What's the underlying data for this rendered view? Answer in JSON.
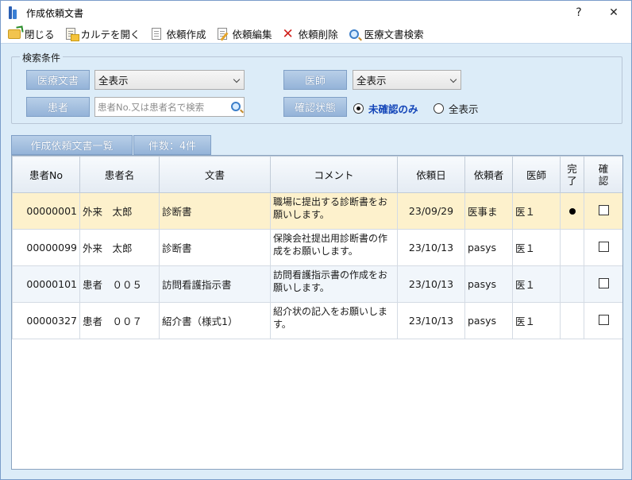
{
  "window": {
    "title": "作成依頼文書",
    "help": "?",
    "close": "✕"
  },
  "toolbar": [
    {
      "label": "閉じる",
      "icon": "folder-close-icon"
    },
    {
      "label": "カルテを開く",
      "icon": "chart-open-icon"
    },
    {
      "label": "依頼作成",
      "icon": "document-icon"
    },
    {
      "label": "依頼編集",
      "icon": "document-edit-icon"
    },
    {
      "label": "依頼削除",
      "icon": "delete-x-icon"
    },
    {
      "label": "医療文書検索",
      "icon": "search-icon"
    }
  ],
  "search": {
    "group_title": "検索条件",
    "doc_label": "医療文書",
    "doc_value": "全表示",
    "doctor_label": "医師",
    "doctor_value": "全表示",
    "patient_label": "患者",
    "patient_placeholder": "患者No.又は患者名で検索",
    "status_label": "確認状態",
    "radio_unconfirmed": "未確認のみ",
    "radio_all": "全表示",
    "selected": "未確認のみ"
  },
  "tabs": {
    "list": "作成依頼文書一覧",
    "count": "件数：4件"
  },
  "columns": [
    "患者No",
    "患者名",
    "文書",
    "コメント",
    "依頼日",
    "依頼者",
    "医師",
    "完了",
    "確認"
  ],
  "rows": [
    {
      "no": "00000001",
      "name": "外来　太郎",
      "doc": "診断書",
      "comment": "職場に提出する診断書をお願いします。",
      "date": "23/09/29",
      "requester": "医事ま",
      "doctor": "医１",
      "done": "●",
      "confirmed": false
    },
    {
      "no": "00000099",
      "name": "外来　太郎",
      "doc": "診断書",
      "comment": "保険会社提出用診断書の作成をお願いします。",
      "date": "23/10/13",
      "requester": "pasys",
      "doctor": "医１",
      "done": "",
      "confirmed": false
    },
    {
      "no": "00000101",
      "name": "患者　００５",
      "doc": "訪問看護指示書",
      "comment": "訪問看護指示書の作成をお願いします。",
      "date": "23/10/13",
      "requester": "pasys",
      "doctor": "医１",
      "done": "",
      "confirmed": false
    },
    {
      "no": "00000327",
      "name": "患者　００７",
      "doc": "紹介書（様式1）",
      "comment": "紹介状の記入をお願いします。",
      "date": "23/10/13",
      "requester": "pasys",
      "doctor": "医１",
      "done": "",
      "confirmed": false
    }
  ]
}
